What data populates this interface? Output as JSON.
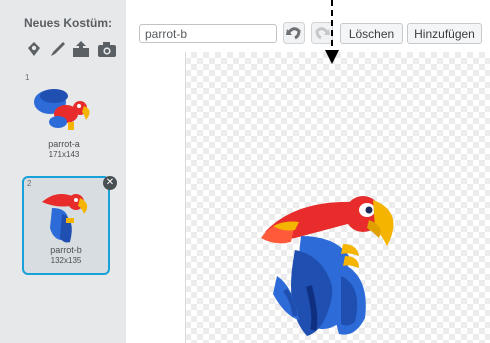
{
  "sidebar": {
    "title": "Neues Kostüm:",
    "tools": [
      "paint-icon",
      "brush-icon",
      "upload-icon",
      "camera-icon"
    ],
    "costumes": [
      {
        "number": "1",
        "name": "parrot-a",
        "size": "171x143",
        "selected": false
      },
      {
        "number": "2",
        "name": "parrot-b",
        "size": "132x135",
        "selected": true
      }
    ]
  },
  "toolbar": {
    "costume_name": "parrot-b",
    "undo_icon": "undo-icon",
    "redo_icon": "redo-icon",
    "clear_label": "Löschen",
    "add_label": "Hinzufügen"
  },
  "colors": {
    "accent": "#1aa0d8",
    "parrot_red": "#e82b2b",
    "parrot_blue": "#2d6bd9",
    "parrot_yellow": "#f5b400"
  }
}
